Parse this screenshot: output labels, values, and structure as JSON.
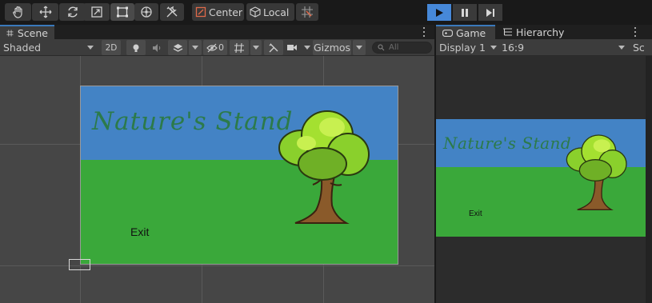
{
  "toolbar": {
    "tools": [
      {
        "icon": "hand-icon"
      },
      {
        "icon": "move-icon"
      },
      {
        "icon": "rotate-icon"
      },
      {
        "icon": "scale-icon"
      },
      {
        "icon": "rect-tool-icon",
        "active": true
      },
      {
        "icon": "transform-icon"
      },
      {
        "icon": "custom-tools-icon"
      }
    ],
    "pivot_mode_label": "Center",
    "pivot_rotation_label": "Local",
    "snap_icon": "grid-snap-icon",
    "playback": [
      {
        "icon": "play-icon",
        "active": true
      },
      {
        "icon": "pause-icon"
      },
      {
        "icon": "step-icon"
      }
    ]
  },
  "scene_panel": {
    "tab_label": "Scene",
    "shading_mode": "Shaded",
    "mode_2d_label": "2D",
    "hidden_count": "0",
    "gizmos_label": "Gizmos",
    "search_placeholder": "All"
  },
  "game_panel": {
    "tabs": [
      {
        "label": "Game",
        "icon": "gamepad-icon",
        "selected": true
      },
      {
        "label": "Hierarchy",
        "icon": "hierarchy-icon",
        "selected": false
      }
    ],
    "display_label": "Display 1",
    "aspect_label": "16:9",
    "scale_label": "Sc"
  },
  "menu_canvas": {
    "title": "Nature's Stand",
    "exit_label": "Exit"
  },
  "colors": {
    "sky": "#4383c5",
    "grass": "#3aa83a",
    "title": "#2c7a4a",
    "play_active": "#4688d8",
    "tab_accent": "#3a79bb"
  }
}
